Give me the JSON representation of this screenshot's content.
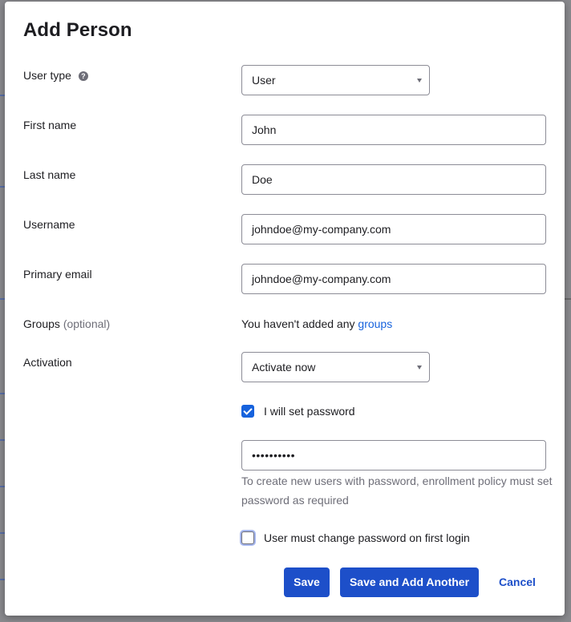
{
  "dialog": {
    "title": "Add Person"
  },
  "form": {
    "user_type": {
      "label": "User type",
      "value": "User"
    },
    "first_name": {
      "label": "First name",
      "value": "John"
    },
    "last_name": {
      "label": "Last name",
      "value": "Doe"
    },
    "username": {
      "label": "Username",
      "value": "johndoe@my-company.com"
    },
    "primary_email": {
      "label": "Primary email",
      "value": "johndoe@my-company.com"
    },
    "groups": {
      "label": "Groups",
      "optional": "(optional)",
      "empty_text": "You haven't added any",
      "link_text": "groups"
    },
    "activation": {
      "label": "Activation",
      "value": "Activate now"
    },
    "set_password": {
      "label": "I will set password",
      "checked": true
    },
    "password": {
      "value": "••••••••••",
      "hint": "To create new users with password, enrollment policy must set password as required"
    },
    "must_change": {
      "label": "User must change password on first login",
      "checked": false
    }
  },
  "actions": {
    "save": "Save",
    "save_and_add": "Save and Add Another",
    "cancel": "Cancel"
  },
  "colors": {
    "primary": "#1d4fc9",
    "link": "#1662dd"
  },
  "icons": {
    "help": "question-circle-icon",
    "caret": "chevron-down-icon"
  }
}
